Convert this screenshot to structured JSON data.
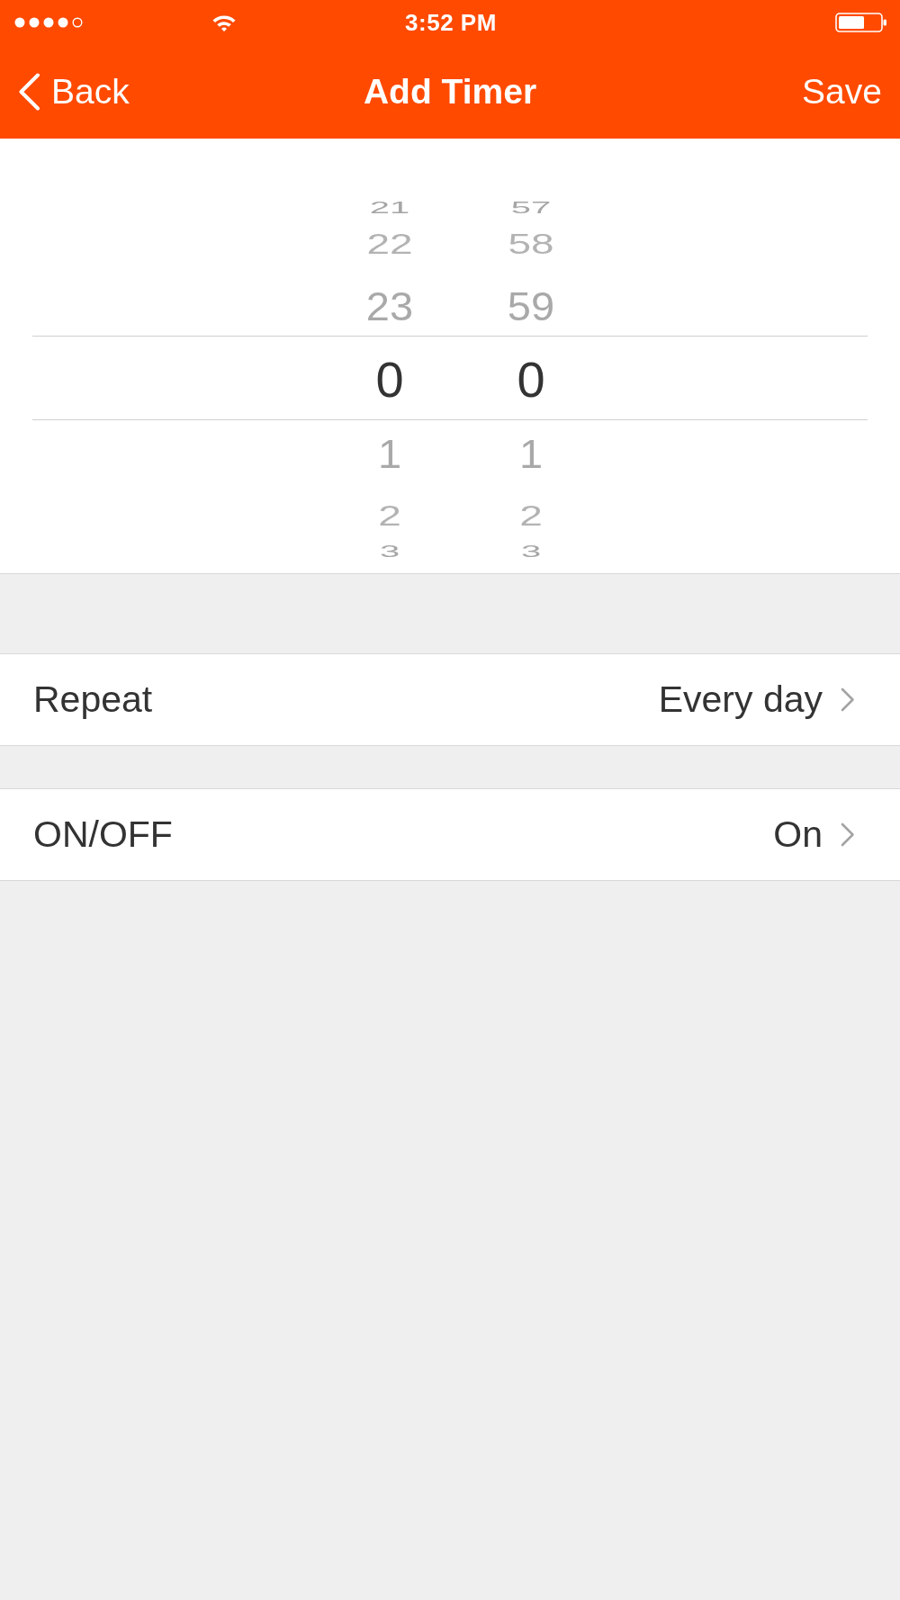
{
  "status_bar": {
    "time": "3:52 PM"
  },
  "nav_bar": {
    "back": "Back",
    "title": "Add Timer",
    "action": "Save"
  },
  "picker": {
    "columns": [
      {
        "items": [
          {
            "label": "21",
            "selected": false
          },
          {
            "label": "22",
            "selected": false
          },
          {
            "label": "23",
            "selected": false
          },
          {
            "label": "0",
            "selected": true
          },
          {
            "label": "1",
            "selected": false
          },
          {
            "label": "2",
            "selected": false
          },
          {
            "label": "3",
            "selected": false
          }
        ]
      },
      {
        "items": [
          {
            "label": "57",
            "selected": false
          },
          {
            "label": "58",
            "selected": false
          },
          {
            "label": "59",
            "selected": false
          },
          {
            "label": "0",
            "selected": true
          },
          {
            "label": "1",
            "selected": false
          },
          {
            "label": "2",
            "selected": false
          },
          {
            "label": "3",
            "selected": false
          }
        ]
      }
    ]
  },
  "rows": [
    {
      "label": "Repeat",
      "value": "Every day"
    },
    {
      "label": "ON/OFF",
      "value": "On"
    }
  ]
}
